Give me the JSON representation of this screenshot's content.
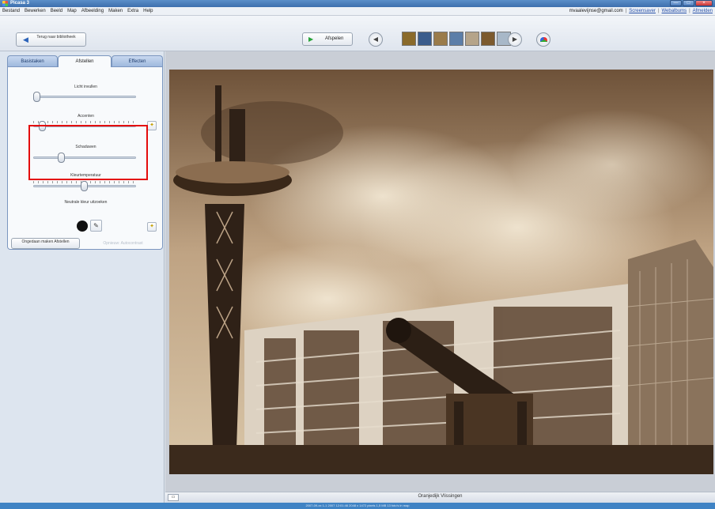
{
  "app": {
    "title": "Picasa 3"
  },
  "window_buttons": {
    "minimize": "—",
    "maximize": "□",
    "close": "×"
  },
  "menu": [
    "Bestand",
    "Bewerken",
    "Beeld",
    "Map",
    "Afbeelding",
    "Maken",
    "Extra",
    "Help"
  ],
  "account": {
    "email": "mvaalevijnse@gmail.com",
    "links": [
      "Screensaver",
      "Webalbums",
      "Afmelden"
    ]
  },
  "toolbar": {
    "back_label": "Terug naar bibliotheek",
    "play_label": "Afspelen",
    "prev_icon": "arrow-left-icon",
    "next_icon": "arrow-right-icon"
  },
  "thumbnails": [
    {
      "color": "#8a6a2a"
    },
    {
      "color": "#3a5c8c"
    },
    {
      "color": "#9a7b4a"
    },
    {
      "color": "#5c7ea8"
    },
    {
      "color": "#b5a48a"
    },
    {
      "color": "#7c5a2e"
    },
    {
      "color": "#a8b8c8"
    }
  ],
  "tabs": [
    "Basistaken",
    "Afstellen",
    "Effecten"
  ],
  "active_tab": 1,
  "sliders": [
    {
      "label": "Licht invullen",
      "value": 0.0
    },
    {
      "label": "Accenten",
      "value": 0.05
    },
    {
      "label": "Schaduwen",
      "value": 0.28
    },
    {
      "label": "Kleurtemperatuur",
      "value": 0.52
    }
  ],
  "neutral_color": {
    "label": "Neutrale kleur uitzoeken",
    "swatch": "#111111"
  },
  "buttons": {
    "undo": "Ongedaan maken Afstellen",
    "redo": "Opnieuw: Autocontrast"
  },
  "photo": {
    "caption": "Oranjedijk Vlissingen"
  },
  "status": {
    "text": "2007-09-xx    1-1 2007 12:01:46    2048 x 1472 pixels    1,5 MB    13 foto's in map"
  },
  "colors": {
    "accent": "#e40b0b",
    "titlebar": "#3d6fae",
    "sepia_light": "#d9c2a0",
    "sepia_dark": "#3b2a1c"
  }
}
